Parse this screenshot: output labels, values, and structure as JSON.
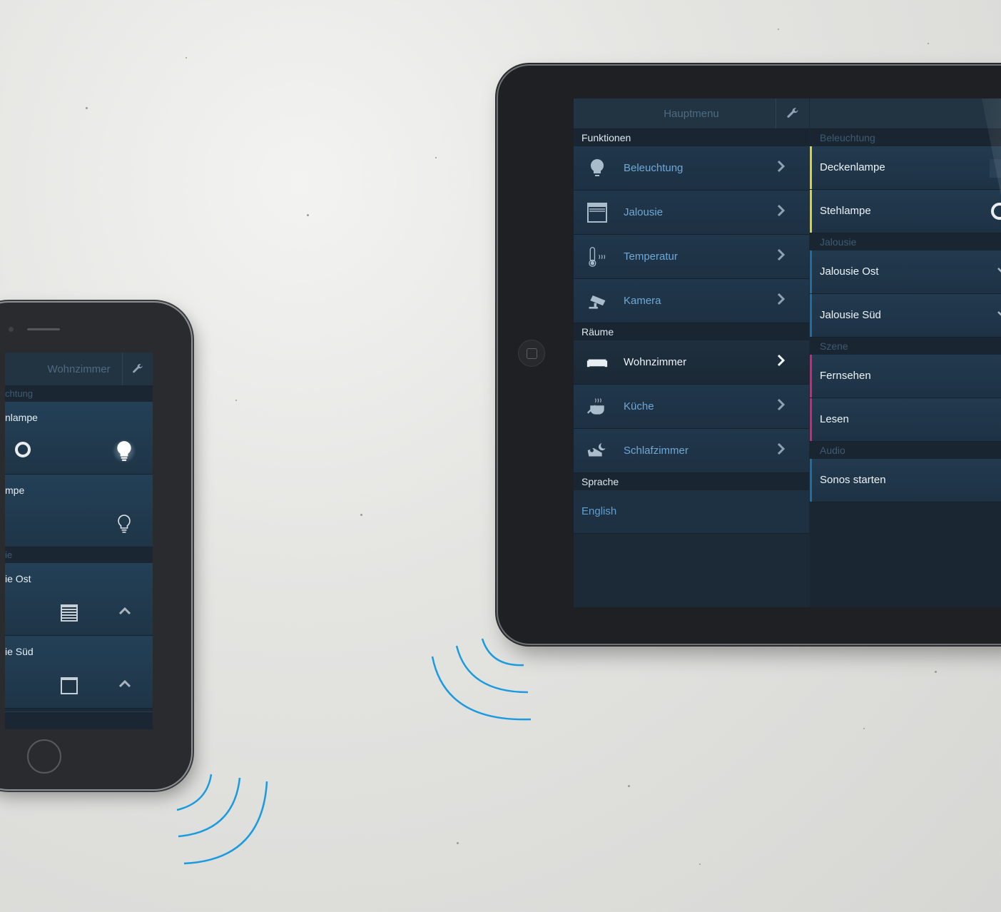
{
  "colors": {
    "accent_blue": "#1a9be0",
    "bar_yellow": "#d8d235",
    "bar_blue": "#1a6fa8",
    "bar_magenta": "#d2257a"
  },
  "phone": {
    "header_title": "Wohnzimmer",
    "header_icon": "wrench-icon",
    "section_lighting": "chtung",
    "items": [
      {
        "label": "nlampe",
        "icons": [
          "toggle-ring-icon",
          "bulb-on-icon"
        ]
      },
      {
        "label": "mpe",
        "icons": [
          "bulb-off-icon"
        ]
      }
    ],
    "section_blinds": "ie",
    "blinds": [
      {
        "label": "ie Ost",
        "icons": [
          "blind-closed-icon",
          "chevron-up-icon"
        ]
      },
      {
        "label": "ie Süd",
        "icons": [
          "blind-open-icon",
          "chevron-up-icon"
        ]
      }
    ]
  },
  "tablet": {
    "header_title": "Hauptmenu",
    "header_icon": "wrench-icon",
    "section_functions": "Funktionen",
    "functions": [
      {
        "label": "Beleuchtung",
        "icon": "bulb-icon"
      },
      {
        "label": "Jalousie",
        "icon": "blind-icon"
      },
      {
        "label": "Temperatur",
        "icon": "thermometer-icon"
      },
      {
        "label": "Kamera",
        "icon": "camera-icon"
      }
    ],
    "section_rooms": "Räume",
    "rooms": [
      {
        "label": "Wohnzimmer",
        "icon": "sofa-icon",
        "active": true
      },
      {
        "label": "Küche",
        "icon": "pot-icon"
      },
      {
        "label": "Schlafzimmer",
        "icon": "bed-icon"
      }
    ],
    "section_language": "Sprache",
    "language": "English",
    "right": {
      "sec_lighting": "Beleuchtung",
      "lighting": [
        "Deckenlampe",
        "Stehlampe"
      ],
      "sec_blinds": "Jalousie",
      "blinds": [
        "Jalousie Ost",
        "Jalousie Süd"
      ],
      "sec_scene": "Szene",
      "scenes": [
        "Fernsehen",
        "Lesen"
      ],
      "sec_audio": "Audio",
      "audio": [
        "Sonos starten"
      ]
    }
  }
}
